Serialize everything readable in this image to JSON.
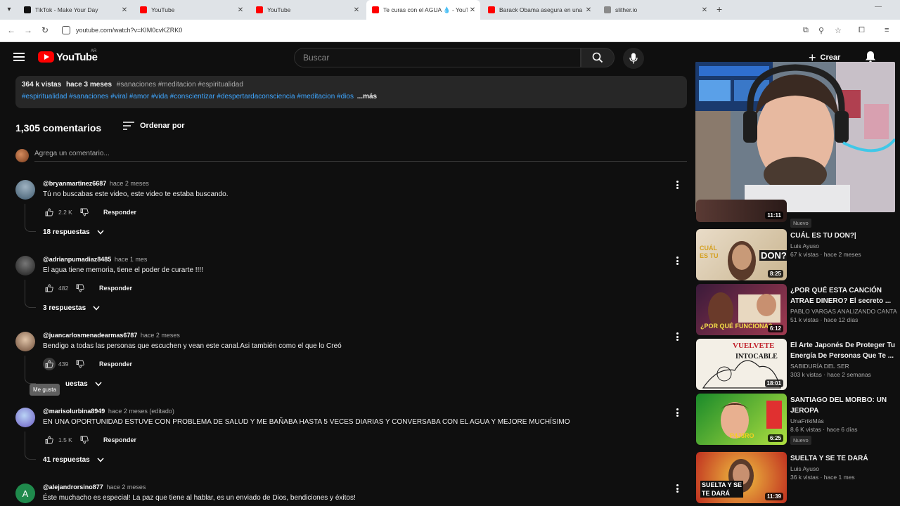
{
  "browser": {
    "tabs": [
      {
        "title": "TikTok - Make Your Day",
        "color": "#111111"
      },
      {
        "title": "YouTube",
        "color": "#ff0000"
      },
      {
        "title": "YouTube",
        "color": "#ff0000"
      },
      {
        "title": "Te curas con el AGUA 💧 - YouTube",
        "color": "#ff0000"
      },
      {
        "title": "Barack Obama asegura en una",
        "color": "#ff0000"
      },
      {
        "title": "slither.io",
        "color": "#8a8a8a"
      }
    ],
    "url": "youtube.com/watch?v=KIM0cvKZRK0"
  },
  "header": {
    "logo_text": "YouTube",
    "country_code": "AR",
    "search_placeholder": "Buscar",
    "create_label": "Crear"
  },
  "description": {
    "views": "364 k vistas",
    "age": "hace 3 meses",
    "tags_line1": "#sanaciones #meditacion #espiritualidad",
    "tags_line2": "#espiritualidad #sanaciones #viral #amor #vida #conscientizar #despertardaconsciencia #meditacion #dios",
    "more": "...más"
  },
  "comments_header": {
    "count": "1,305 comentarios",
    "sort_label": "Ordenar por",
    "add_placeholder": "Agrega un comentario..."
  },
  "comments": [
    {
      "user": "@bryanmartinez6687",
      "time": "hace 2 meses",
      "text": "Tú no buscabas este video, este video te estaba buscando.",
      "likes": "2.2 K",
      "reply": "Responder",
      "replies": "18 respuestas"
    },
    {
      "user": "@adrianpumadiaz8485",
      "time": "hace 1 mes",
      "text": "El agua tiene memoria, tiene el poder de curarte !!!!",
      "likes": "482",
      "reply": "Responder",
      "replies": "3 respuestas"
    },
    {
      "user": "@juancarlosmenadearmas6787",
      "time": "hace 2 meses",
      "text": "Bendigo a todas las personas que escuchen y vean este canal.Asi también como el que lo Creó",
      "likes": "439",
      "reply": "Responder",
      "replies": "uestas"
    },
    {
      "user": "@marisolurbina8949",
      "time": "hace 2 meses (editado)",
      "text": "EN UNA OPORTUNIDAD ESTUVE CON PROBLEMA DE SALUD Y ME BAÑABA HASTA 5 VECES DIARIAS Y CONVERSABA CON EL AGUA Y MEJORE MUCHÍSIMO",
      "likes": "1.5 K",
      "reply": "Responder",
      "replies": "41 respuestas"
    },
    {
      "user": "@alejandrorsino877",
      "time": "hace 2 meses",
      "text": "Éste muchacho es especial! La paz que tiene al hablar, es un enviado de Dios, bendiciones y éxitos!",
      "avatar_letter": "A"
    }
  ],
  "tooltip": "Me gusta",
  "sidebar": {
    "partial_video": {
      "duration": "11:11",
      "badge": "Nuevo"
    },
    "videos": [
      {
        "title": "CUÁL ES TU DON?|",
        "channel": "Luis Ayuso",
        "meta": "67 k vistas · hace 2 meses",
        "duration": "8:25",
        "thumb_text_1": "CUÁL ES TU",
        "thumb_text_2": "DON?"
      },
      {
        "title": "¿POR QUÉ ESTA CANCIÓN ATRAE DINERO? El secreto ...",
        "channel": "PABLO VARGAS ANALIZANDO CANTANTES",
        "meta": "51 k vistas · hace 12 días",
        "duration": "6:12",
        "thumb_text_1": "¿POR QUÉ FUNCIONA?"
      },
      {
        "title": "El Arte Japonés De Proteger Tu Energía De Personas Que Te ...",
        "channel": "SABIDURÍA DEL SER",
        "meta": "303 k vistas · hace 2 semanas",
        "duration": "18:01",
        "thumb_text_1": "VUELVETE",
        "thumb_text_2": "INTOCABLE"
      },
      {
        "title": "SANTIAGO DEL MORBO: UN JEROPA",
        "channel": "UnaFrikiMás",
        "meta": "8.6 K vistas · hace 6 días",
        "duration": "6:25",
        "badge": "Nuevo",
        "thumb_text_1": "P4J3RO"
      },
      {
        "title": "SUELTA Y SE TE DARÁ",
        "channel": "Luis Ayuso",
        "meta": "36 k vistas · hace 1 mes",
        "duration": "11:39",
        "thumb_text_1": "SUELTA Y SE",
        "thumb_text_2": "TE DARÁ"
      }
    ]
  }
}
